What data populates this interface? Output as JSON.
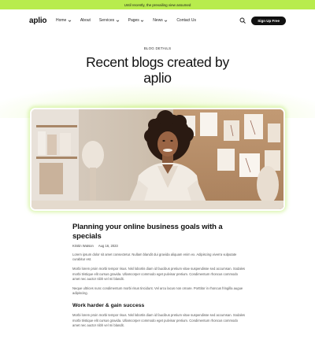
{
  "banner": {
    "text": "Until recently, the prevailing view assumed"
  },
  "nav": {
    "logo": "aplio",
    "items": [
      {
        "label": "Home",
        "dropdown": true
      },
      {
        "label": "About",
        "dropdown": false
      },
      {
        "label": "Services",
        "dropdown": true
      },
      {
        "label": "Pages",
        "dropdown": true
      },
      {
        "label": "News",
        "dropdown": true
      },
      {
        "label": "Contact Us",
        "dropdown": false
      }
    ],
    "search_icon": "search-icon",
    "signup_label": "Sign Up Free"
  },
  "hero": {
    "eyebrow": "BLOG DETAILS",
    "title": "Recent blogs created by aplio"
  },
  "article": {
    "title": "Planning your online business goals with a specials",
    "author": "Kristin Watson",
    "date": "Aug 16, 2023",
    "paragraphs": [
      "Lorem ipsum dolor sit amet consectetur. Nullam blandit dui gravida aliquam enim ex. Adipiscing viverra vulputate curabitur est.",
      "Morbi lorem proin morbi tempor risus. Nisl lobortis diam id faucibus pretium vitae suspendisse sed accumsan. Sodales morbi tristique elit cursus gravida. Ullamcorper commodo eget pulvinar pretium. Condimentum rhoncus commodo amet nec auctor nibh vel mi blandit.",
      "Neque ultrices nunc condimentum morbi risus tincidunt. Vel arcu lacus non ornare. Porttitor in rhoncus fringilla augue adipiscing."
    ],
    "section_title": "Work harder & gain success",
    "section_paragraph": "Morbi lorem proin morbi tempor risus. Nisl lobortis diam id faucibus pretium vitae suspendisse sed accumsan. Sodales morbi tristique elit cursus gravida. Ullamcorper commodo eget pulvinar pretium. Condimentum rhoncus commodo amet nec auctor nibh vel mi blandit."
  },
  "colors": {
    "accent": "#b8ec4d",
    "dark": "#111111"
  }
}
